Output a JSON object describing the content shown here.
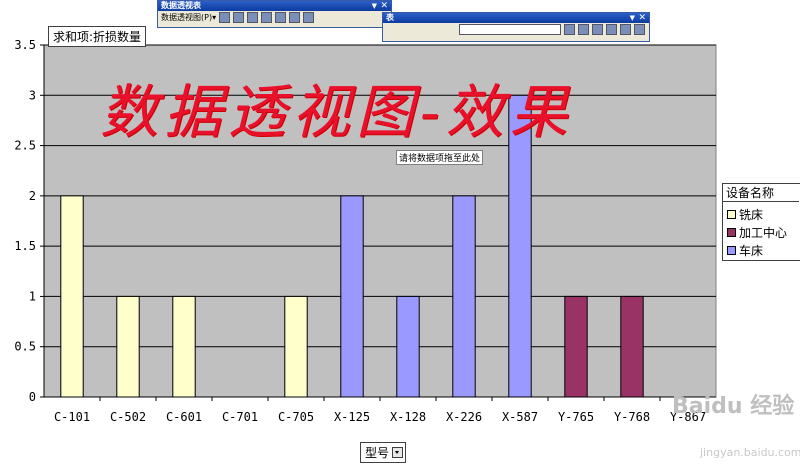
{
  "chart_data": {
    "type": "bar",
    "categories": [
      "C-101",
      "C-502",
      "C-601",
      "C-701",
      "C-705",
      "X-125",
      "X-128",
      "X-226",
      "X-587",
      "Y-765",
      "Y-768",
      "Y-867"
    ],
    "series": [
      {
        "name": "铣床",
        "color": "#ffffcc",
        "values": [
          2,
          1,
          1,
          0,
          1,
          0,
          0,
          0,
          0,
          0,
          0,
          0
        ]
      },
      {
        "name": "加工中心",
        "color": "#993366",
        "values": [
          0,
          0,
          0,
          0,
          0,
          0,
          0,
          0,
          0,
          1,
          1,
          0
        ]
      },
      {
        "name": "车床",
        "color": "#9999ff",
        "values": [
          0,
          0,
          0,
          0,
          0,
          2,
          1,
          2,
          3,
          0,
          0,
          0
        ]
      }
    ],
    "ylim": [
      0,
      3.5
    ],
    "yticks": [
      "0",
      "0.5",
      "1",
      "1.5",
      "2",
      "2.5",
      "3",
      "3.5"
    ],
    "grid": true,
    "plot_background": "#c0c0c0",
    "legend_placement": "right",
    "legend_title": "设备名称",
    "data_field": "求和项:折损数量",
    "category_field": "型号"
  },
  "overlay": {
    "handwriting": "数据透视图-效果",
    "drop_hint": "请将数据项拖至此处",
    "watermark": "Baidu 经验",
    "watermark_sub": "jingyan.baidu.com"
  },
  "toolbars": {
    "pivot": {
      "title": "数据透视表",
      "menu_label": "数据透视图(P)▾"
    },
    "second": {
      "title": "表"
    }
  }
}
